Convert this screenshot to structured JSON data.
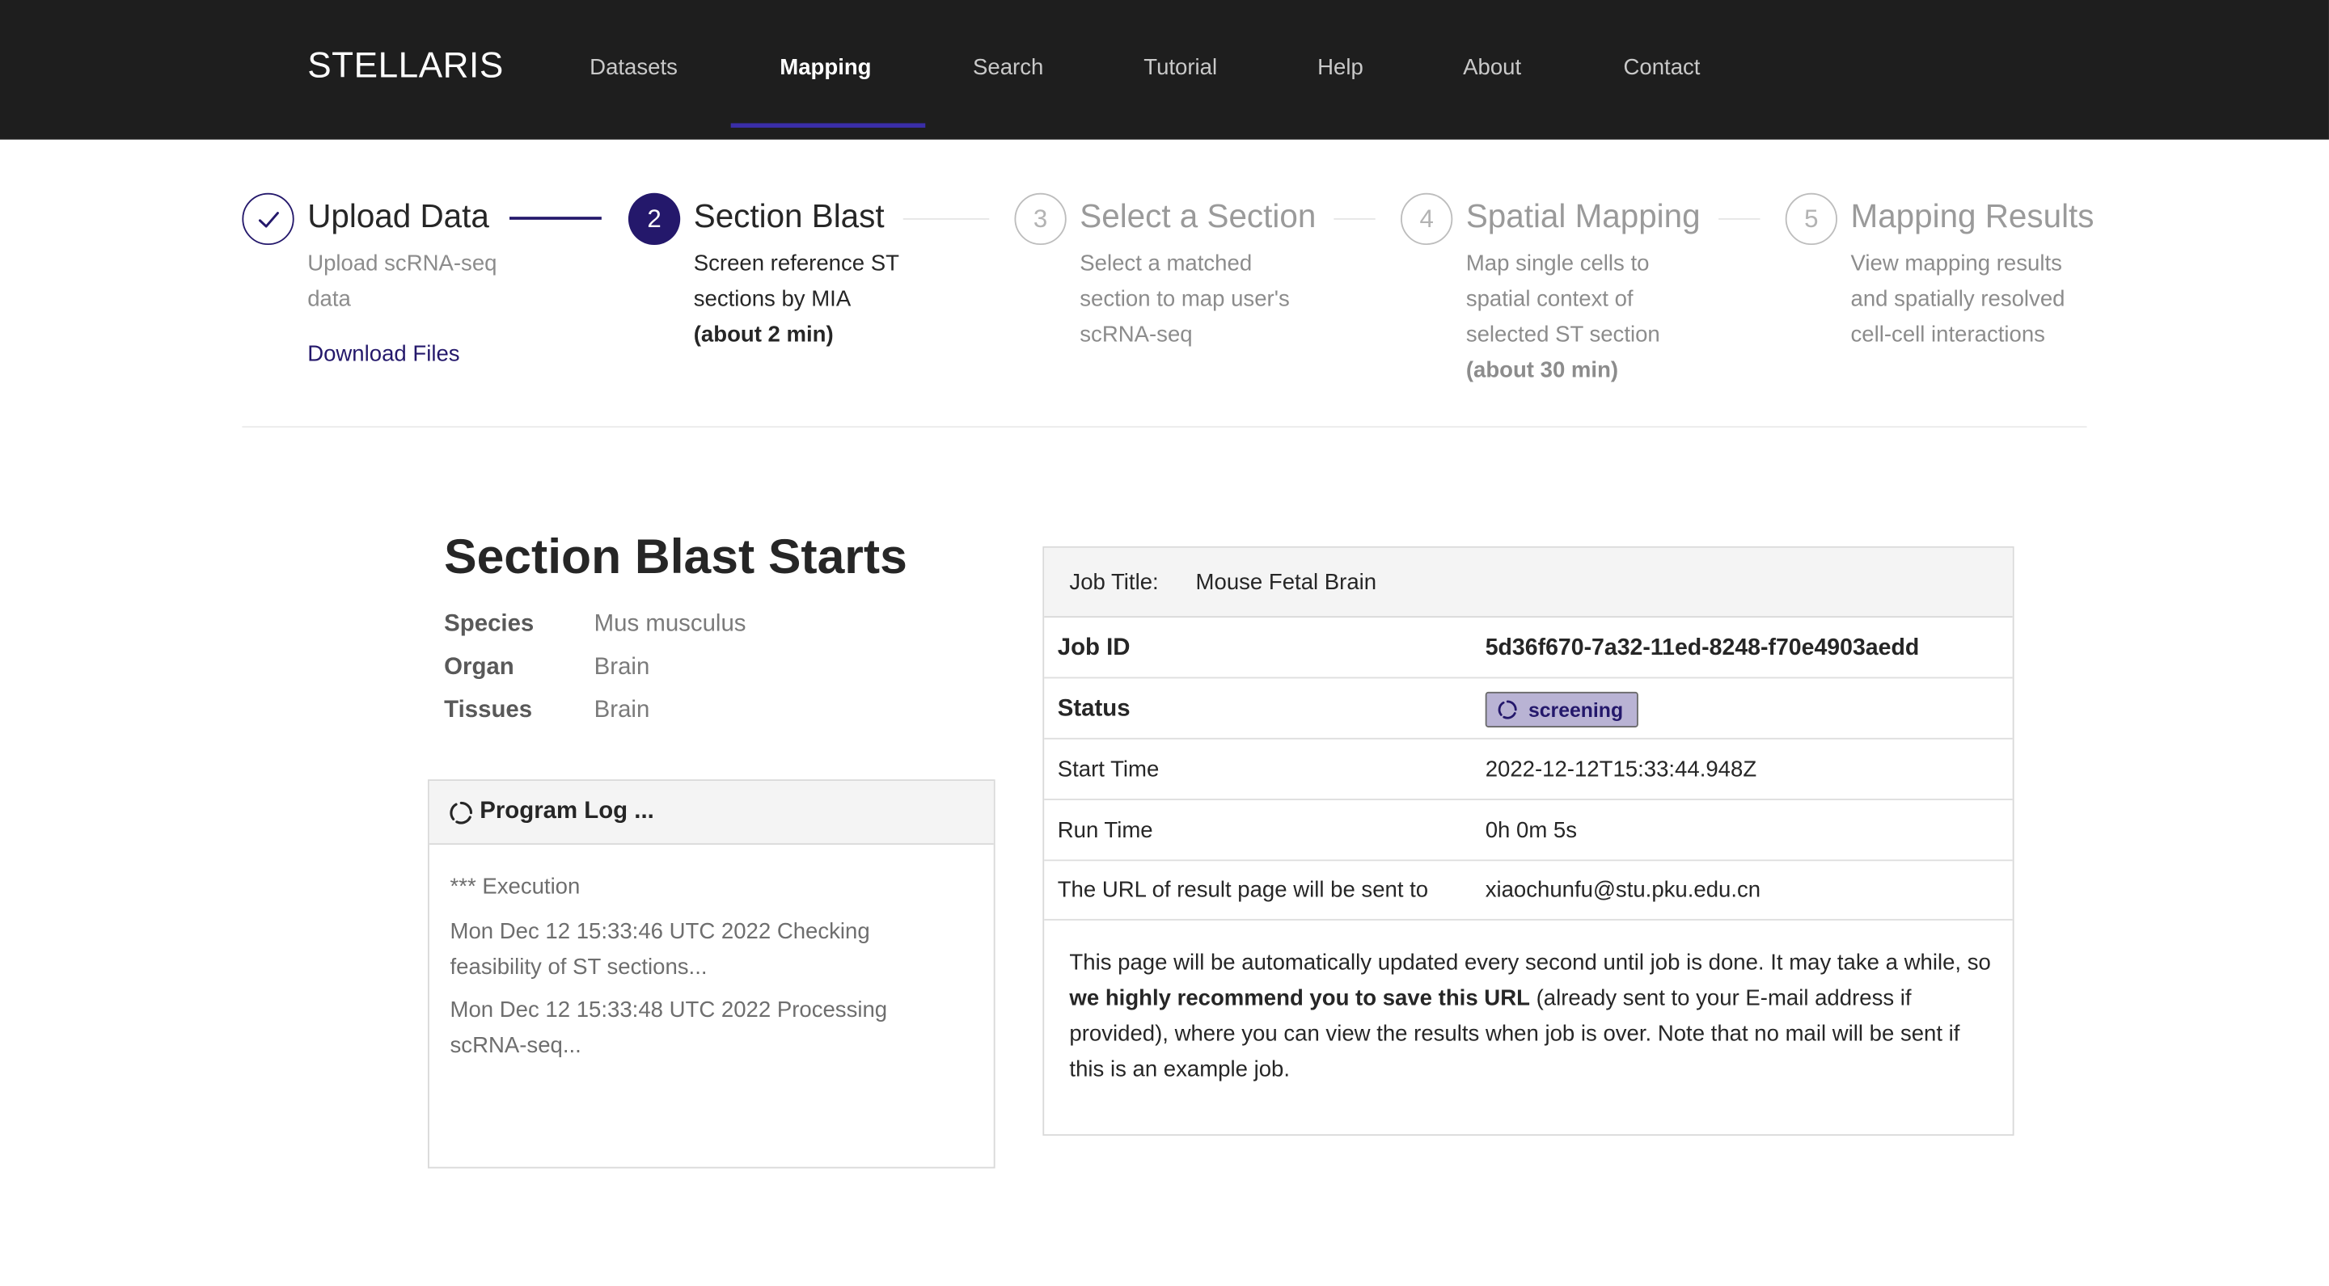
{
  "header": {
    "logo": "STELLARIS",
    "nav": [
      "Datasets",
      "Mapping",
      "Search",
      "Tutorial",
      "Help",
      "About",
      "Contact"
    ],
    "active_nav": "Mapping"
  },
  "steps": [
    {
      "number": "1",
      "title": "Upload Data",
      "desc": [
        "Upload scRNA-seq",
        "data"
      ],
      "state": "done",
      "link": "Download Files"
    },
    {
      "number": "2",
      "title": "Section Blast",
      "desc": [
        "Screen reference ST",
        "sections by MIA"
      ],
      "note": "(about 2 min)",
      "state": "current"
    },
    {
      "number": "3",
      "title": "Select a Section",
      "desc": [
        "Select a matched",
        "section to map user's",
        "scRNA-seq"
      ],
      "state": "pending"
    },
    {
      "number": "4",
      "title": "Spatial Mapping",
      "desc": [
        "Map single cells to",
        "spatial context of",
        "selected ST section"
      ],
      "note": "(about 30 min)",
      "state": "pending"
    },
    {
      "number": "5",
      "title": "Mapping Results",
      "desc": [
        "View mapping results",
        "and spatially resolved",
        "cell-cell interactions"
      ],
      "state": "pending"
    }
  ],
  "section": {
    "title": "Section Blast Starts",
    "info": [
      {
        "label": "Species",
        "value": "Mus musculus"
      },
      {
        "label": "Organ",
        "value": "Brain"
      },
      {
        "label": "Tissues",
        "value": "Brain"
      }
    ]
  },
  "log": {
    "title": "Program Log ...",
    "lines": [
      [
        "*** Execution"
      ],
      [
        "Mon Dec 12 15:33:46 UTC 2022 Checking",
        "feasibility of ST sections..."
      ],
      [
        "Mon Dec 12 15:33:48 UTC 2022 Processing",
        "scRNA-seq..."
      ]
    ]
  },
  "job": {
    "title_label": "Job Title:",
    "title_value": "Mouse Fetal Brain",
    "rows": [
      {
        "label": "Job ID",
        "value": "5d36f670-7a32-11ed-8248-f70e4903aedd"
      },
      {
        "label": "Status",
        "value": "screening"
      },
      {
        "label": "Start Time",
        "value": "2022-12-12T15:33:44.948Z"
      },
      {
        "label": "Run Time",
        "value": "0h 0m 5s"
      },
      {
        "label": "The URL of result page will be sent to",
        "value": "xiaochunfu@stu.pku.edu.cn"
      }
    ],
    "note_pre": "This page will be automatically updated every second until job is done. It may take a while, so ",
    "note_bold": "we highly recommend you to save this URL",
    "note_post": " (already sent to your E-mail address if provided), where you can view the results when job is over. Note that no mail will be sent if this is an example job."
  },
  "colors": {
    "header_bg": "#1e1e1e",
    "accent": "#24186b",
    "badge_bg": "#b9b3d4"
  },
  "icons": [
    "check-icon",
    "loading-spinner-icon"
  ]
}
